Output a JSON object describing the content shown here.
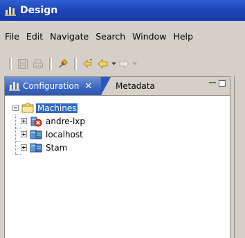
{
  "window": {
    "title": "Design",
    "title_bar_color": "#1e44b8"
  },
  "menu": [
    "File",
    "Edit",
    "Navigate",
    "Search",
    "Window",
    "Help"
  ],
  "toolbar": {
    "buttons": [
      "save-icon",
      "print-icon",
      "pin-icon",
      "back-history-icon",
      "back-arrow-icon",
      "forward-arrow-icon"
    ]
  },
  "panel": {
    "tabs": [
      {
        "label": "Configuration",
        "active": true
      },
      {
        "label": "Metadata",
        "active": false
      }
    ],
    "tab_active_color": "#3b65c3",
    "selection_color": "#316ac5"
  },
  "tree": {
    "root": {
      "label": "Machines",
      "expanded": true
    },
    "children": [
      {
        "label": "andre-lxp",
        "status": "error"
      },
      {
        "label": "localhost",
        "status": "ok"
      },
      {
        "label": "Stam",
        "status": "ok"
      }
    ]
  }
}
